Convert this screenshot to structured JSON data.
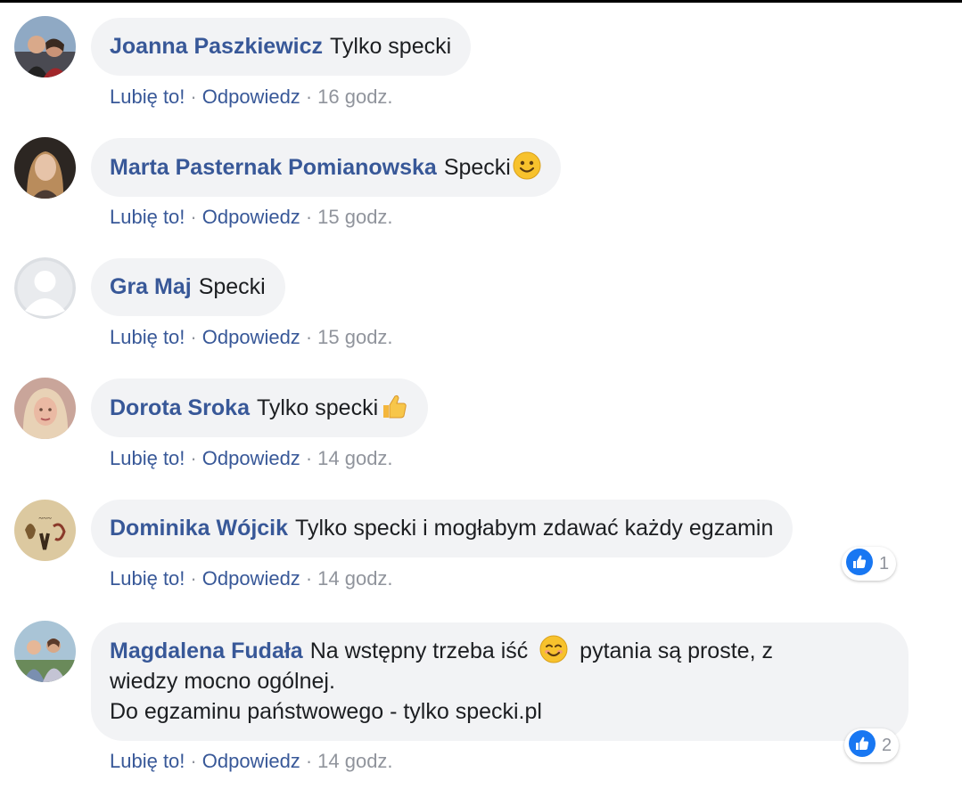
{
  "actions": {
    "like": "Lubię to!",
    "reply": "Odpowiedz",
    "separator": "·"
  },
  "comments": [
    {
      "author": "Joanna Paszkiewicz",
      "text": "Tylko specki",
      "time": "16 godz.",
      "avatar": "avatar-photo-couple"
    },
    {
      "author": "Marta Pasternak Pomianowska",
      "text": "Specki",
      "emoji": "smiling-face-emoji",
      "time": "15 godz.",
      "avatar": "avatar-photo-woman"
    },
    {
      "author": "Gra Maj",
      "text": "Specki",
      "time": "15 godz.",
      "avatar": "default-avatar-silhouette"
    },
    {
      "author": "Dorota Sroka",
      "text": "Tylko specki",
      "emoji": "thumbs-up-emoji",
      "time": "14 godz.",
      "avatar": "avatar-photo-woman-blonde"
    },
    {
      "author": "Dominika Wójcik",
      "text": "Tylko specki i mogłabym zdawać każdy egzamin",
      "time": "14 godz.",
      "reaction_count": "1",
      "avatar": "avatar-artwork"
    },
    {
      "author": "Magdalena Fudała",
      "text_line1a": "Na wstępny trzeba iść",
      "text_line1b": "pytania są proste, z",
      "text_line2": "wiedzy mocno ogólnej.",
      "text_line3": "Do egzaminu państwowego - tylko specki.pl",
      "emoji": "smiling-face-emoji",
      "time": "14 godz.",
      "reaction_count": "2",
      "avatar": "avatar-photo-family"
    }
  ],
  "colors": {
    "link": "#385898",
    "meta_gray": "#90949c",
    "bubble": "#f2f3f5",
    "like_blue": "#1877f2"
  }
}
